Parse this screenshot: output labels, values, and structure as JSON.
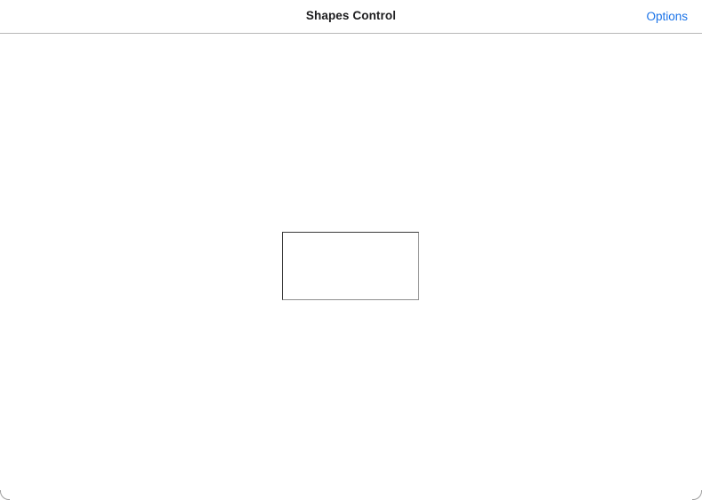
{
  "nav": {
    "title": "Shapes Control",
    "options_label": "Options"
  },
  "colors": {
    "accent": "#1a73e8",
    "title_text": "#1c1c1e",
    "divider": "#b7b7b7",
    "shape_border": "#3a3a3a",
    "background": "#ffffff"
  },
  "canvas": {
    "shapes": [
      {
        "type": "rectangle"
      }
    ]
  }
}
